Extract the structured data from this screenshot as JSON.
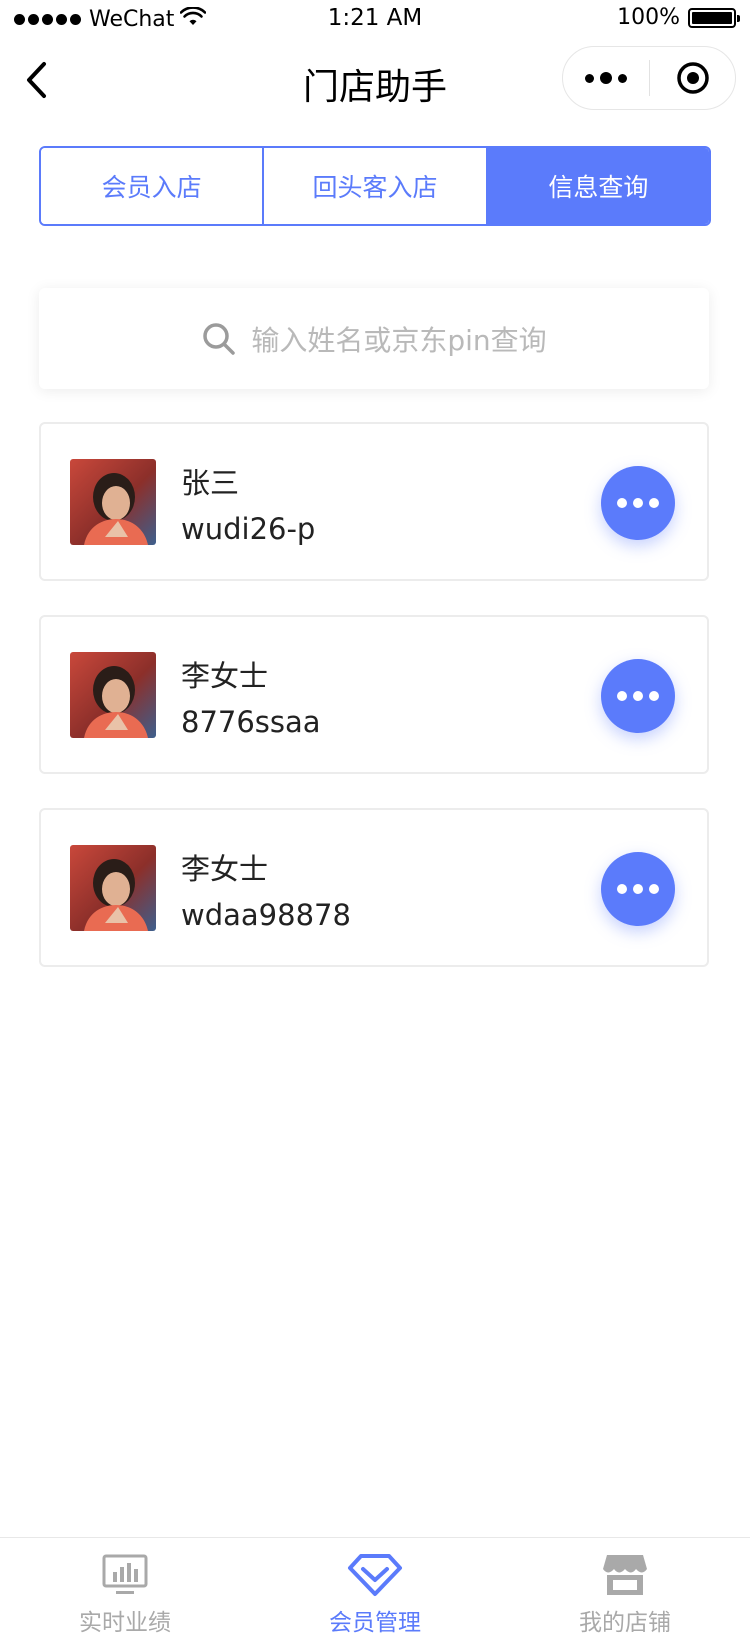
{
  "status_bar": {
    "carrier": "WeChat",
    "time": "1:21 AM",
    "battery": "100%"
  },
  "nav": {
    "title": "门店助手"
  },
  "tabs": [
    {
      "label": "会员入店",
      "active": false
    },
    {
      "label": "回头客入店",
      "active": false
    },
    {
      "label": "信息查询",
      "active": true
    }
  ],
  "search": {
    "placeholder": "输入姓名或京东pin查询"
  },
  "members": [
    {
      "name": "张三",
      "pin": "wudi26-p"
    },
    {
      "name": "李女士",
      "pin": "8776ssaa"
    },
    {
      "name": "李女士",
      "pin": "wdaa98878"
    }
  ],
  "tabbar": [
    {
      "label": "实时业绩",
      "icon": "chart-icon",
      "active": false
    },
    {
      "label": "会员管理",
      "icon": "diamond-icon",
      "active": true
    },
    {
      "label": "我的店铺",
      "icon": "store-icon",
      "active": false
    }
  ],
  "colors": {
    "accent": "#5b7bfb",
    "inactive": "#a9a9a9"
  }
}
